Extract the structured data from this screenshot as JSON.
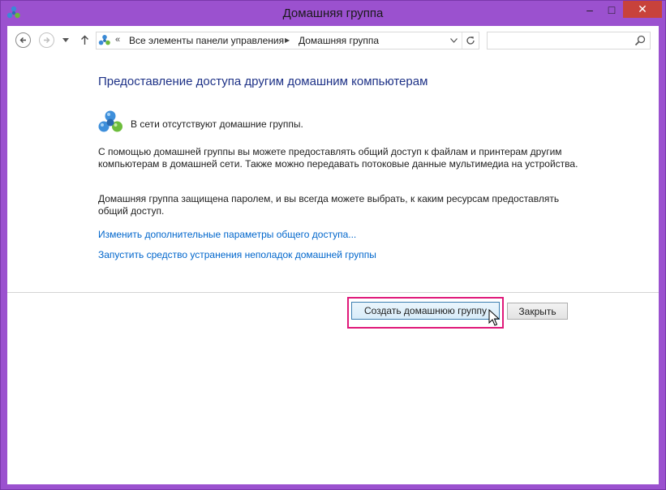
{
  "window": {
    "title": "Домашняя группа",
    "title_color": "#9b51cf",
    "close_color": "#c8423b",
    "controls": {
      "minimize": "‒",
      "maximize": "□",
      "close": "✕"
    }
  },
  "navigation": {
    "back_icon": "back-arrow-icon",
    "forward_icon": "forward-arrow-icon",
    "up_icon": "up-arrow-icon",
    "address": {
      "overflow": "«",
      "crumbs": [
        "Все элементы панели управления",
        "Домашняя группа"
      ],
      "separator": "▶"
    },
    "search": {
      "placeholder": "",
      "value": ""
    }
  },
  "content": {
    "heading": "Предоставление доступа другим домашним компьютерам",
    "status": "В сети отсутствуют домашние группы.",
    "paragraph_1": "С помощью домашней группы вы можете предоставлять общий доступ к файлам и принтерам другим компьютерам в домашней сети. Также можно передавать потоковые данные мультимедиа на устройства.",
    "paragraph_2": "Домашняя группа защищена паролем, и вы всегда можете выбрать, к каким ресурсам предоставлять общий доступ.",
    "links": [
      "Изменить дополнительные параметры общего доступа...",
      "Запустить средство устранения неполадок домашней группы"
    ]
  },
  "buttons": {
    "create": "Создать домашнюю группу",
    "close": "Закрыть"
  },
  "accent": {
    "heading_color": "#1e3287",
    "link_color": "#0066cc",
    "highlight_color": "#e0197a"
  }
}
